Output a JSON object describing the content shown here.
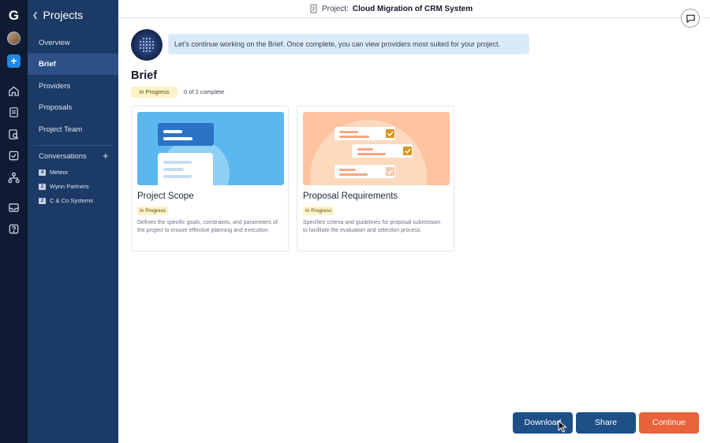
{
  "rail": {
    "logo": "G",
    "icons": [
      "home-icon",
      "document-icon",
      "search-doc-icon",
      "checklist-icon",
      "org-chart-icon",
      "inbox-icon",
      "help-icon"
    ]
  },
  "sidebar": {
    "header": "Projects",
    "items": [
      {
        "label": "Overview"
      },
      {
        "label": "Brief",
        "active": true
      },
      {
        "label": "Providers"
      },
      {
        "label": "Proposals"
      },
      {
        "label": "Project Team"
      }
    ],
    "conversations_label": "Conversations",
    "conversations": [
      {
        "count": "4",
        "name": "Meteor"
      },
      {
        "count": "2",
        "name": "Wynn Partners"
      },
      {
        "count": "2",
        "name": "C & Co Systems"
      }
    ]
  },
  "header": {
    "prefix": "Project:",
    "project_name": "Cloud Migration of CRM System"
  },
  "assistant": {
    "message": "Let’s continue working on the Brief. Once complete, you can view providers most suited for your project."
  },
  "brief": {
    "title": "Brief",
    "status": "In Progress",
    "progress": "0 of 2 complete"
  },
  "cards": [
    {
      "title": "Project Scope",
      "status": "In Progress",
      "description": "Defines the specific goals, constraints, and parameters of the project to ensure effective planning and execution."
    },
    {
      "title": "Proposal Requirements",
      "status": "In Progress",
      "description": "Specifies criteria and guidelines for proposal submission to facilitate the evaluation and selection process."
    }
  ],
  "actions": {
    "download": "Download",
    "share": "Share",
    "continue": "Continue"
  },
  "colors": {
    "rail": "#0f1b33",
    "sidebar": "#1c3a66",
    "primary_button": "#1e4f86",
    "accent_button": "#e8623a",
    "badge": "#fdf3c8"
  }
}
